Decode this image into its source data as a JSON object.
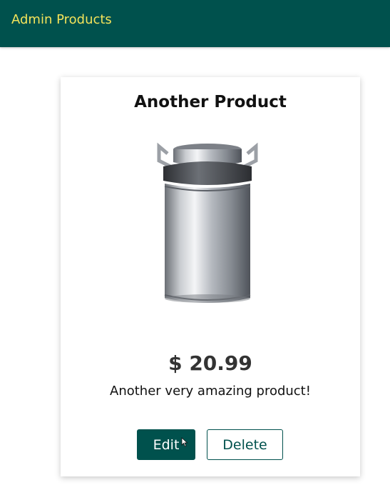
{
  "header": {
    "title": "Admin Products",
    "title_color": "#f3e35a",
    "background_color": "#00514d"
  },
  "product": {
    "title": "Another Product",
    "image_icon": "milk-can-image",
    "price": "$ 20.99",
    "description": "Another very amazing product!",
    "actions": {
      "edit_label": "Edit",
      "delete_label": "Delete"
    }
  }
}
